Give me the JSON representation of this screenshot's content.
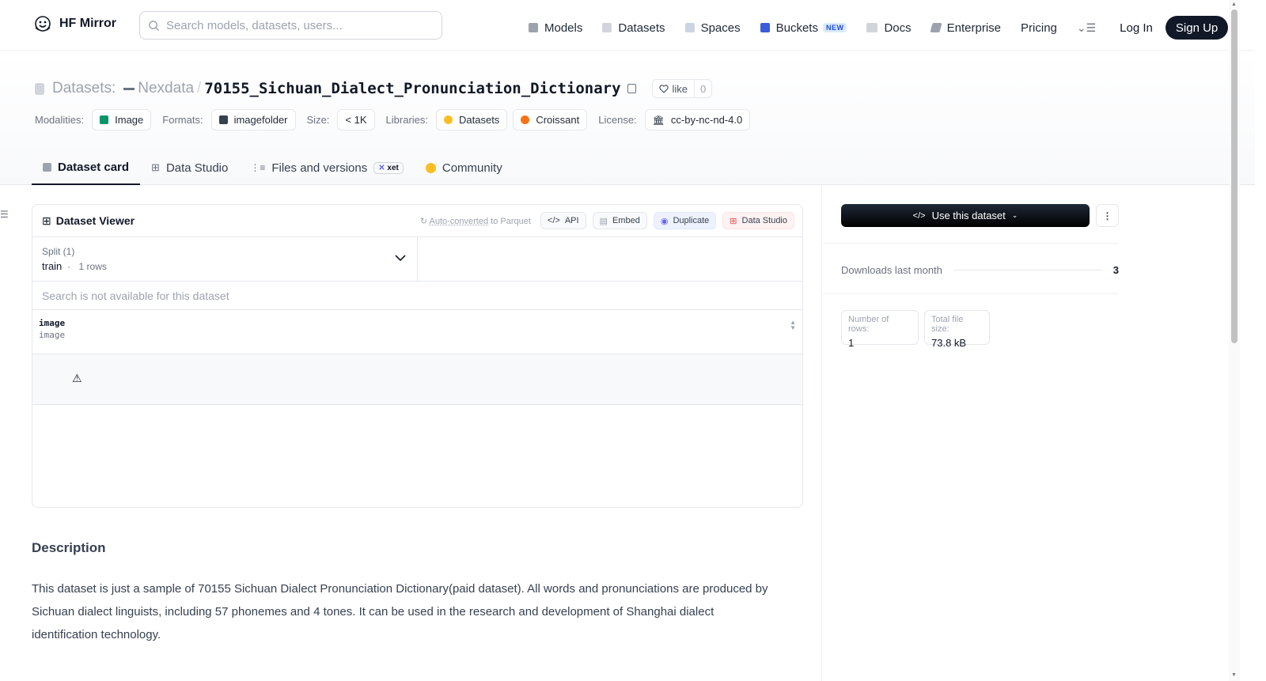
{
  "nav": {
    "brand": "HF Mirror",
    "search_placeholder": "Search models, datasets, users...",
    "links": [
      "Models",
      "Datasets",
      "Spaces",
      "Buckets",
      "Docs",
      "Enterprise",
      "Pricing"
    ],
    "buckets_badge": "NEW",
    "login": "Log In",
    "signup": "Sign Up"
  },
  "header": {
    "kind": "Datasets:",
    "org": "Nexdata",
    "separator": "/",
    "name": "70155_Sichuan_Dialect_Pronunciation_Dictionary",
    "like_label": "like",
    "like_count": "0",
    "meta": {
      "modalities_label": "Modalities:",
      "modality": "Image",
      "formats_label": "Formats:",
      "format": "imagefolder",
      "size_label": "Size:",
      "size": "< 1K",
      "libraries_label": "Libraries:",
      "library_1": "Datasets",
      "library_2": "Croissant",
      "license_label": "License:",
      "license": "cc-by-nc-nd-4.0"
    },
    "tabs": [
      "Dataset card",
      "Data Studio",
      "Files and versions",
      "Community"
    ],
    "xet_badge": "xet"
  },
  "viewer": {
    "title": "Dataset Viewer",
    "auto_converted": "Auto-converted",
    "to_parquet": "to Parquet",
    "actions": [
      "API",
      "Embed",
      "Duplicate",
      "Data Studio"
    ],
    "split_label": "Split (1)",
    "split_value": "train",
    "split_rows": "1 rows",
    "search_na": "Search is not available for this dataset",
    "column_name": "image",
    "column_type": "image",
    "cell_warning": "⚠"
  },
  "description": {
    "title": "Description",
    "text": "This dataset is just a sample of 70155 Sichuan Dialect Pronunciation Dictionary(paid dataset). All words and pronunciations are produced by Sichuan dialect linguists, including 57 phonemes and 4 tones. It can be used in the research and development of Shanghai dialect identification technology."
  },
  "sidebar": {
    "use_button": "Use this dataset",
    "downloads_label": "Downloads last month",
    "downloads_value": "3",
    "rows_label": "Number of rows:",
    "rows_value": "1",
    "size_label": "Total file size:",
    "size_value": "73.8 kB"
  },
  "colors": {
    "accent_dark": "#111827",
    "muted": "#6b7280",
    "border": "#e5e7eb"
  }
}
